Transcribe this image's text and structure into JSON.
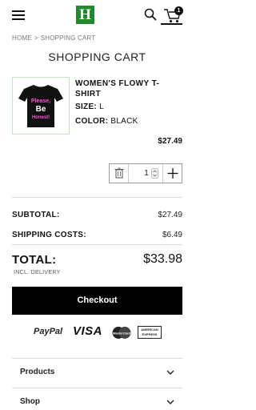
{
  "header": {
    "logo_letter": "H",
    "cart_count": "1"
  },
  "breadcrumb": {
    "home": "HOME",
    "separator": ">",
    "current": "SHOPPING CART"
  },
  "page_title": "SHOPPING CART",
  "cart_item": {
    "name": "WOMEN'S FLOWY T-SHIRT",
    "size_label": "SIZE:",
    "size_value": "L",
    "color_label": "COLOR:",
    "color_value": "BLACK",
    "price": "$27.49",
    "quantity": "1",
    "image_text": [
      "Please,",
      "Be",
      "Honest!"
    ]
  },
  "summary": {
    "subtotal_label": "SUBTOTAL:",
    "subtotal_value": "$27.49",
    "shipping_label": "SHIPPING COSTS:",
    "shipping_value": "$6.49",
    "total_label": "TOTAL:",
    "total_value": "$33.98",
    "total_note": "INCL. DELIVERY"
  },
  "checkout_label": "Checkout",
  "payment_methods": {
    "paypal": "PayPal",
    "visa": "VISA",
    "mastercard": "MasterCard",
    "amex_line1": "AMERICAN",
    "amex_line2": "EXPRESS"
  },
  "accordion": [
    "Products",
    "Shop"
  ],
  "colors": {
    "brand_green": "#1e8a2a",
    "button_black": "#000000",
    "tshirt_pink": "#ff4fd8"
  }
}
